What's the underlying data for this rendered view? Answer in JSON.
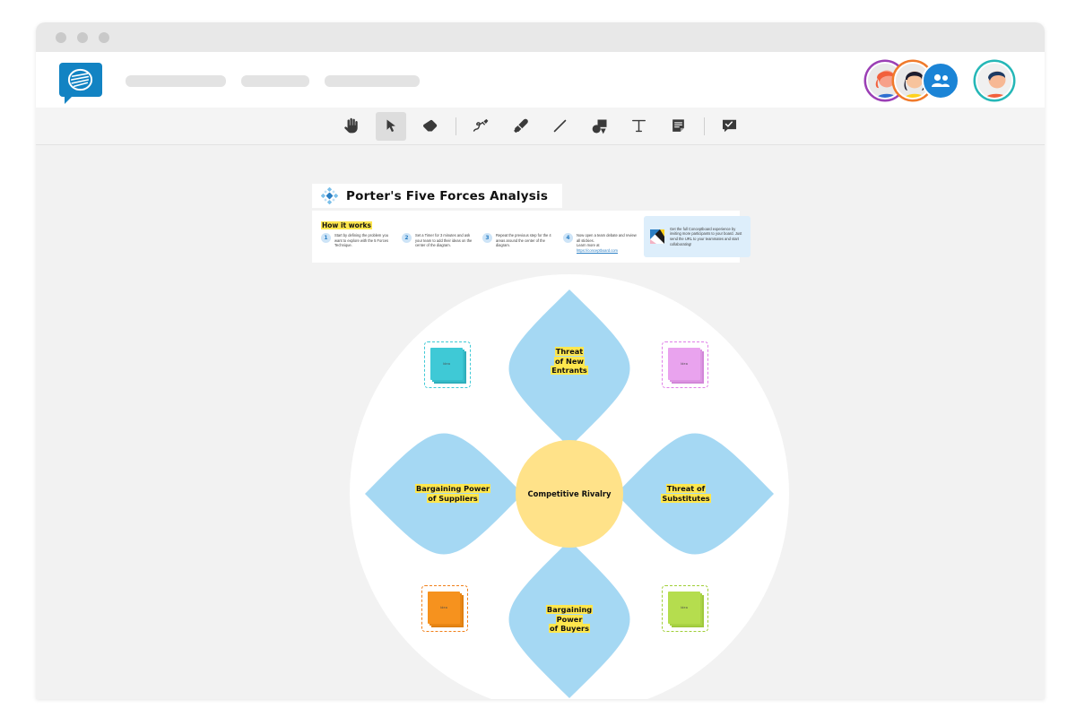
{
  "window": {
    "controls": [
      "close",
      "minimize",
      "maximize"
    ]
  },
  "header": {
    "logo_name": "conceptboard-logo",
    "nav_placeholders": [
      "",
      "",
      ""
    ],
    "avatars": [
      {
        "name": "collaborator-avatar-1",
        "ring_color": "#9b3fb5"
      },
      {
        "name": "collaborator-avatar-2",
        "ring_color": "#f07a2b"
      },
      {
        "name": "add-people-button",
        "color": "#1b84d6",
        "icon": "people-icon"
      },
      {
        "name": "current-user-avatar",
        "ring_color": "#25b7b7"
      }
    ]
  },
  "toolbar": {
    "tools": [
      {
        "id": "hand",
        "label": "Pan",
        "icon": "hand-icon",
        "active": false
      },
      {
        "id": "select",
        "label": "Select",
        "icon": "cursor-icon",
        "active": true
      },
      {
        "id": "eraser",
        "label": "Eraser",
        "icon": "eraser-icon",
        "active": false
      },
      {
        "id": "pen",
        "label": "Pen",
        "icon": "pen-icon",
        "active": false
      },
      {
        "id": "highlighter",
        "label": "Highlighter",
        "icon": "highlighter-icon",
        "active": false
      },
      {
        "id": "line",
        "label": "Line",
        "icon": "line-icon",
        "active": false
      },
      {
        "id": "shapes",
        "label": "Shapes",
        "icon": "shapes-icon",
        "active": false
      },
      {
        "id": "text",
        "label": "Text",
        "icon": "text-icon",
        "active": false
      },
      {
        "id": "sticky",
        "label": "Sticky note",
        "icon": "sticky-note-icon",
        "active": false
      },
      {
        "id": "comment",
        "label": "Comment",
        "icon": "comment-icon",
        "active": false
      }
    ]
  },
  "board": {
    "title": "Porter's Five Forces Analysis",
    "title_icon": "five-forces-flower-icon",
    "how_it_works": {
      "heading": "How it works",
      "steps": [
        {
          "number": "1",
          "text": "Start by defining the problem you want to explore with the 5 Forces Technique."
        },
        {
          "number": "2",
          "text": "Set a Timer for 3 minutes and ask your team to add their ideas on the center of the diagram."
        },
        {
          "number": "3",
          "text": "Repeat the previous step for the 4 areas around the center of the diagram."
        },
        {
          "number": "4",
          "text": "Now open a team debate and review all stickies.",
          "link_prefix": "Learn more at ",
          "link_text": "https://conceptboard.com"
        }
      ],
      "promo": {
        "icon": "conceptboard-mark-icon",
        "text": "Get the full Conceptboard experience by inviting more participants to your board. Just send the URL to your teammates and start collaborating!"
      }
    }
  },
  "diagram": {
    "center": {
      "label": "Competitive Rivalry",
      "color": "#ffe289"
    },
    "petal_color": "#a5d8f3",
    "arrow_color": "#ffd21e",
    "backdrop_color": "#ffffff",
    "forces": [
      {
        "id": "threat-new-entrants",
        "position": "top",
        "lines": [
          "Threat",
          "of New",
          "Entrants"
        ]
      },
      {
        "id": "bargaining-power-suppliers",
        "position": "left",
        "lines": [
          "Bargaining Power",
          "of Suppliers"
        ]
      },
      {
        "id": "threat-substitutes",
        "position": "right",
        "lines": [
          "Threat of",
          "Substitutes"
        ]
      },
      {
        "id": "bargaining-power-buyers",
        "position": "bottom",
        "lines": [
          "Bargaining",
          "Power",
          "of Buyers"
        ]
      }
    ],
    "sticky_notes": [
      {
        "id": "sticky-top-left",
        "color": "#3fc9d6",
        "shade": "#2eaebb",
        "border": "#3fc9d6",
        "text": "Idea"
      },
      {
        "id": "sticky-top-right",
        "color": "#e9a3ee",
        "shade": "#d287d8",
        "border": "#e07fe8",
        "text": "Idea"
      },
      {
        "id": "sticky-bottom-left",
        "color": "#f6921e",
        "shade": "#df7f10",
        "border": "#f0801a",
        "text": "Idea"
      },
      {
        "id": "sticky-bottom-right",
        "color": "#b5dd4e",
        "shade": "#9fc93c",
        "border": "#9fce36",
        "text": "Idea"
      }
    ]
  }
}
